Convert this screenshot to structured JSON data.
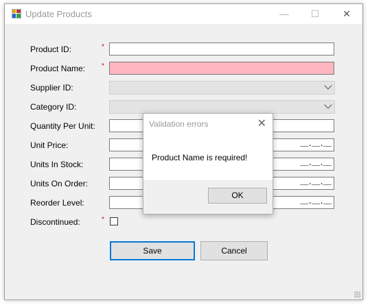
{
  "window": {
    "title": "Update Products",
    "minimize_glyph": "—",
    "maximize_glyph": "☐",
    "close_glyph": "✕"
  },
  "form": {
    "required_mark": "*",
    "fields": [
      {
        "label": "Product ID:",
        "required": true,
        "type": "text",
        "value": ""
      },
      {
        "label": "Product Name:",
        "required": true,
        "type": "text",
        "value": "",
        "error": true
      },
      {
        "label": "Supplier ID:",
        "type": "combo",
        "value": ""
      },
      {
        "label": "Category ID:",
        "type": "combo",
        "value": ""
      },
      {
        "label": "Quantity Per Unit:",
        "type": "text",
        "value": ""
      },
      {
        "label": "Unit Price:",
        "type": "masked",
        "mask": "__.__.__"
      },
      {
        "label": "Units In Stock:",
        "type": "masked",
        "mask": "__.__.__"
      },
      {
        "label": "Units On Order:",
        "type": "masked",
        "mask": "__.__.__"
      },
      {
        "label": "Reorder Level:",
        "type": "masked",
        "mask": "__.__.__"
      },
      {
        "label": "Discontinued:",
        "required": true,
        "type": "checkbox",
        "checked": false
      }
    ],
    "save_label": "Save",
    "cancel_label": "Cancel"
  },
  "dialog": {
    "title": "Validation errors",
    "message": "Product Name is required!",
    "ok_label": "OK",
    "close_glyph": "✕"
  },
  "colors": {
    "error_field": "#ffb6c1",
    "required_mark": "#e00000",
    "focus_border": "#0078d7"
  }
}
